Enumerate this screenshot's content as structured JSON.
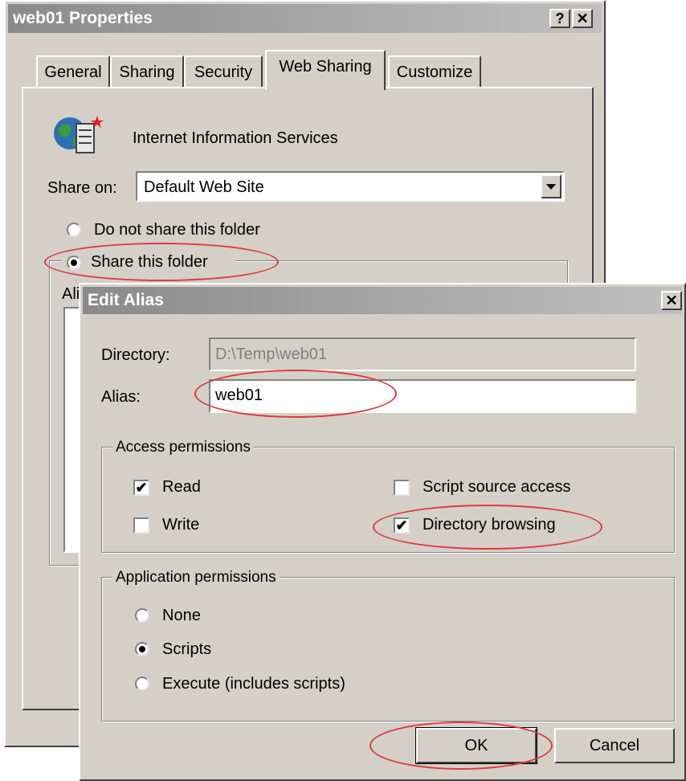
{
  "properties": {
    "title": "web01 Properties",
    "help_label": "?",
    "close_label": "✕",
    "tabs": [
      {
        "label": "General"
      },
      {
        "label": "Sharing"
      },
      {
        "label": "Security"
      },
      {
        "label": "Web Sharing"
      },
      {
        "label": "Customize"
      }
    ],
    "service_name": "Internet Information Services",
    "share_on_label": "Share on:",
    "share_on_value": "Default Web Site",
    "do_not_share_label": "Do not share this folder",
    "share_label": "Share this folder",
    "aliases_label_partial": "Ali",
    "selected_option": "Share this folder"
  },
  "edit_alias": {
    "title": "Edit Alias",
    "close_label": "✕",
    "directory_label": "Directory:",
    "directory_value": "D:\\Temp\\web01",
    "alias_label": "Alias:",
    "alias_value": "web01",
    "access_group_label": "Access permissions",
    "access": [
      {
        "label": "Read",
        "checked": true
      },
      {
        "label": "Write",
        "checked": false
      },
      {
        "label": "Script source access",
        "checked": false
      },
      {
        "label": "Directory browsing",
        "checked": true
      }
    ],
    "app_group_label": "Application permissions",
    "app_options": [
      {
        "label": "None",
        "selected": false
      },
      {
        "label": "Scripts",
        "selected": true
      },
      {
        "label": "Execute (includes scripts)",
        "selected": false
      }
    ],
    "ok_label": "OK",
    "cancel_label": "Cancel"
  },
  "colors": {
    "dialog_bg": "#d4d0c8",
    "highlight_ellipse": "#e0383b"
  }
}
